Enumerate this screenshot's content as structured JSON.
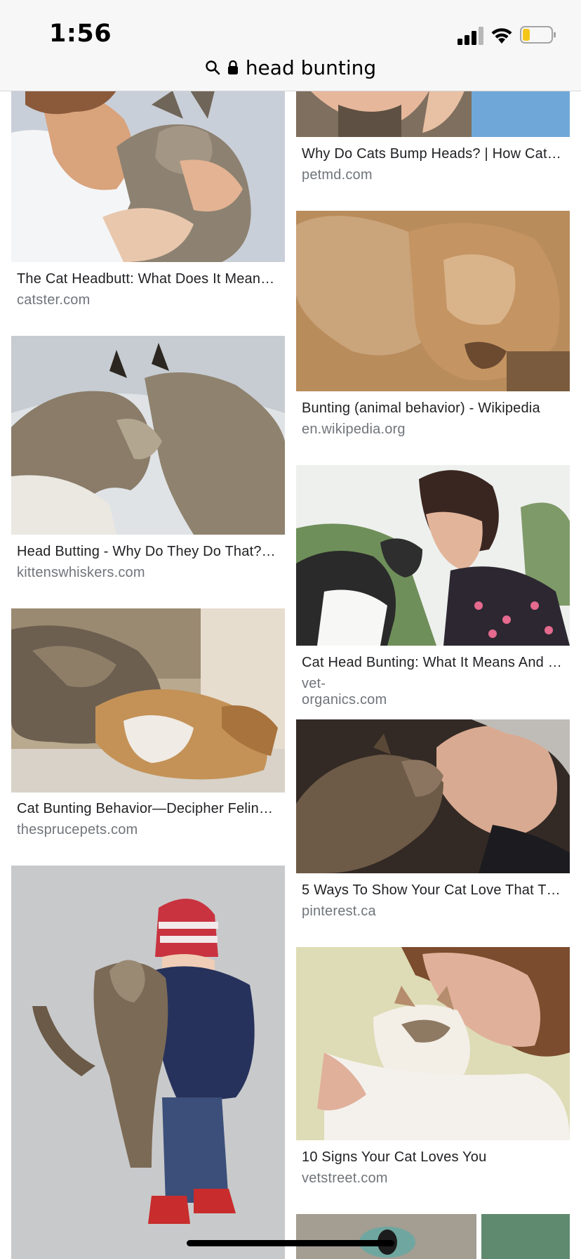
{
  "status_bar": {
    "time": "1:56"
  },
  "address_bar": {
    "query": "head bunting"
  },
  "results": {
    "left": [
      {
        "title": "The Cat Headbutt: What Does It Mean, …",
        "source": "catster.com"
      },
      {
        "title": "Head Butting - Why Do They Do That? |…",
        "source": "kittenswhiskers.com"
      },
      {
        "title": "Cat Bunting Behavior—Decipher Feline …",
        "source": "thesprucepets.com"
      }
    ],
    "right": [
      {
        "title": "Why Do Cats Bump Heads? | How Cats…",
        "source": "petmd.com"
      },
      {
        "title": "Bunting (animal behavior) - Wikipedia",
        "source": "en.wikipedia.org"
      },
      {
        "title": "Cat Head Bunting: What It Means And …",
        "source": "vet-organics.com"
      },
      {
        "title": "5 Ways To Show Your Cat Love That T…",
        "source": "pinterest.ca"
      },
      {
        "title": "10 Signs Your Cat Loves You",
        "source": "vetstreet.com"
      }
    ]
  },
  "colors": {
    "topbar_bg": "#f7f7f7",
    "title_text": "#202124",
    "source_text": "#70757a",
    "battery_fill": "#f5c518"
  }
}
